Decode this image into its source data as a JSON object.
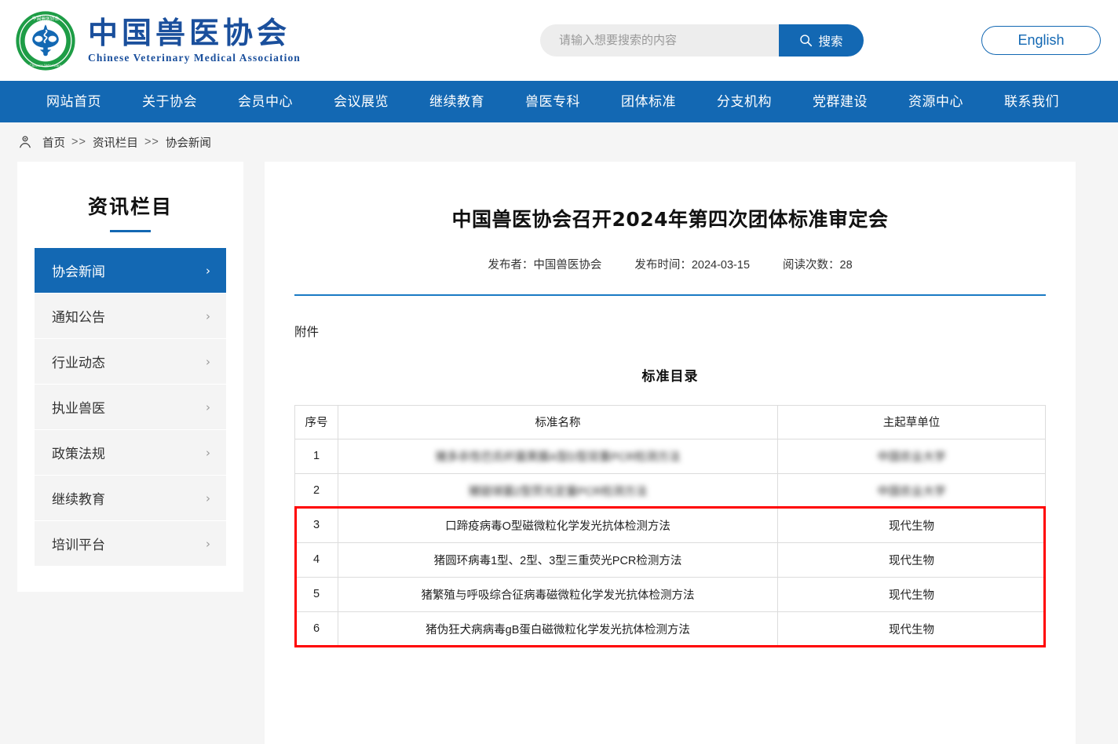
{
  "header": {
    "logo_name_cn": "中国兽医协会",
    "logo_name_en": "Chinese Veterinary Medical Association",
    "search": {
      "placeholder": "请输入想要搜索的内容",
      "value": "",
      "button_label": "搜索"
    },
    "language_button": "English"
  },
  "nav": {
    "items": [
      {
        "label": "网站首页"
      },
      {
        "label": "关于协会"
      },
      {
        "label": "会员中心"
      },
      {
        "label": "会议展览"
      },
      {
        "label": "继续教育"
      },
      {
        "label": "兽医专科"
      },
      {
        "label": "团体标准"
      },
      {
        "label": "分支机构"
      },
      {
        "label": "党群建设"
      },
      {
        "label": "资源中心"
      },
      {
        "label": "联系我们"
      }
    ]
  },
  "breadcrumb": {
    "items": [
      {
        "label": "首页"
      },
      {
        "label": "资讯栏目"
      },
      {
        "label": "协会新闻"
      }
    ],
    "separator": ">>"
  },
  "sidebar": {
    "title": "资讯栏目",
    "items": [
      {
        "label": "协会新闻",
        "active": true
      },
      {
        "label": "通知公告",
        "active": false
      },
      {
        "label": "行业动态",
        "active": false
      },
      {
        "label": "执业兽医",
        "active": false
      },
      {
        "label": "政策法规",
        "active": false
      },
      {
        "label": "继续教育",
        "active": false
      },
      {
        "label": "培训平台",
        "active": false
      }
    ],
    "chevron": "›"
  },
  "article": {
    "title": "中国兽医协会召开2024年第四次团体标准审定会",
    "meta": {
      "author": "发布者：中国兽医协会",
      "publish_time": "发布时间：2024-03-15",
      "views": "阅读次数：28"
    },
    "attachment_label": "附件",
    "table_caption": "标准目录"
  },
  "table": {
    "headers": [
      "序号",
      "标准名称",
      "主起草单位"
    ],
    "rows": [
      {
        "index": "1",
        "name": "猪多杀性巴氏杆菌荚膜A型D型双重PCR检测方法",
        "unit": "中国农业大学",
        "blurred": true,
        "highlighted": false
      },
      {
        "index": "2",
        "name": "猪链球菌2型荧光定量PCR检测方法",
        "unit": "中国农业大学",
        "blurred": true,
        "highlighted": false
      },
      {
        "index": "3",
        "name": "口蹄疫病毒O型磁微粒化学发光抗体检测方法",
        "unit": "现代生物",
        "blurred": false,
        "highlighted": true
      },
      {
        "index": "4",
        "name": "猪圆环病毒1型、2型、3型三重荧光PCR检测方法",
        "unit": "现代生物",
        "blurred": false,
        "highlighted": true
      },
      {
        "index": "5",
        "name": "猪繁殖与呼吸综合征病毒磁微粒化学发光抗体检测方法",
        "unit": "现代生物",
        "blurred": false,
        "highlighted": true
      },
      {
        "index": "6",
        "name": "猪伪狂犬病病毒gB蛋白磁微粒化学发光抗体检测方法",
        "unit": "现代生物",
        "blurred": false,
        "highlighted": true
      }
    ]
  },
  "colors": {
    "brand_blue": "#1368b3",
    "brand_green": "#1e9d46",
    "logo_text_blue": "#1a4f9c",
    "highlight_red": "#ff0000",
    "page_bg": "#f5f5f5"
  }
}
